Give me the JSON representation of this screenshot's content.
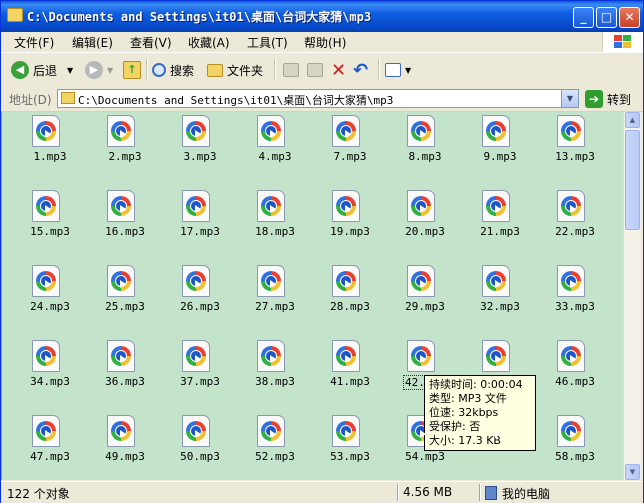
{
  "window": {
    "title": "C:\\Documents and Settings\\it01\\桌面\\台词大家猜\\mp3"
  },
  "menu": [
    "文件(F)",
    "编辑(E)",
    "查看(V)",
    "收藏(A)",
    "工具(T)",
    "帮助(H)"
  ],
  "toolbar": {
    "back_label": "后退",
    "search_label": "搜索",
    "folders_label": "文件夹"
  },
  "address": {
    "label": "地址(D)",
    "value": "C:\\Documents and Settings\\it01\\桌面\\台词大家猜\\mp3",
    "go_label": "转到"
  },
  "files": [
    "1.mp3",
    "2.mp3",
    "3.mp3",
    "4.mp3",
    "7.mp3",
    "8.mp3",
    "9.mp3",
    "13.mp3",
    "15.mp3",
    "16.mp3",
    "17.mp3",
    "18.mp3",
    "19.mp3",
    "20.mp3",
    "21.mp3",
    "22.mp3",
    "24.mp3",
    "25.mp3",
    "26.mp3",
    "27.mp3",
    "28.mp3",
    "29.mp3",
    "32.mp3",
    "33.mp3",
    "34.mp3",
    "36.mp3",
    "37.mp3",
    "38.mp3",
    "41.mp3",
    "42.mp3",
    "",
    "46.mp3",
    "47.mp3",
    "49.mp3",
    "50.mp3",
    "52.mp3",
    "53.mp3",
    "54.mp3",
    "",
    "58.mp3"
  ],
  "tooltip": {
    "duration": "持续时间: 0:00:04",
    "type": "类型: MP3 文件",
    "bitrate": "位速: 32kbps",
    "protected": "受保护: 否",
    "size": "大小: 17.3 KB"
  },
  "status": {
    "count": "122 个对象",
    "size": "4.56 MB",
    "location": "我的电脑"
  },
  "colors": {
    "content_bg": "#c3e3cb",
    "title_bar": "#0a5fd8",
    "tooltip_bg": "#ffffe1"
  }
}
